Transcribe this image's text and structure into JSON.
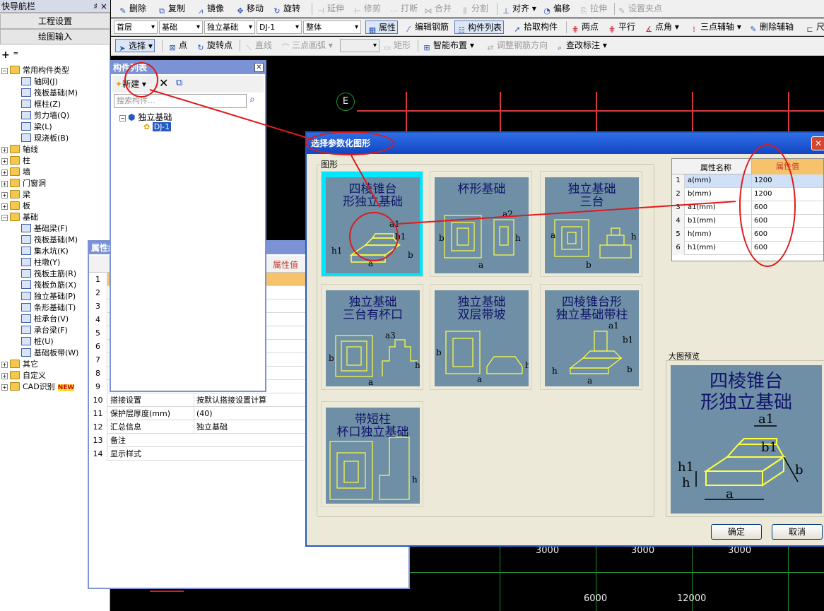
{
  "nav": {
    "title": "快导航栏",
    "pin": "♯ ×",
    "btn_settings": "工程设置",
    "btn_draw": "绘图输入",
    "tree": [
      {
        "label": "常用构件类型",
        "level": 0,
        "type": "folder",
        "exp": "−"
      },
      {
        "label": "轴网(J)",
        "level": 1,
        "type": "comp"
      },
      {
        "label": "筏板基础(M)",
        "level": 1,
        "type": "comp"
      },
      {
        "label": "框柱(Z)",
        "level": 1,
        "type": "comp"
      },
      {
        "label": "剪力墙(Q)",
        "level": 1,
        "type": "comp"
      },
      {
        "label": "梁(L)",
        "level": 1,
        "type": "comp"
      },
      {
        "label": "现浇板(B)",
        "level": 1,
        "type": "comp"
      },
      {
        "label": "轴线",
        "level": 0,
        "type": "folder",
        "exp": "+"
      },
      {
        "label": "柱",
        "level": 0,
        "type": "folder",
        "exp": "+"
      },
      {
        "label": "墙",
        "level": 0,
        "type": "folder",
        "exp": "+"
      },
      {
        "label": "门窗洞",
        "level": 0,
        "type": "folder",
        "exp": "+"
      },
      {
        "label": "梁",
        "level": 0,
        "type": "folder",
        "exp": "+"
      },
      {
        "label": "板",
        "level": 0,
        "type": "folder",
        "exp": "+"
      },
      {
        "label": "基础",
        "level": 0,
        "type": "folder",
        "exp": "−"
      },
      {
        "label": "基础梁(F)",
        "level": 1,
        "type": "comp"
      },
      {
        "label": "筏板基础(M)",
        "level": 1,
        "type": "comp"
      },
      {
        "label": "集水坑(K)",
        "level": 1,
        "type": "comp"
      },
      {
        "label": "柱墩(Y)",
        "level": 1,
        "type": "comp"
      },
      {
        "label": "筏板主筋(R)",
        "level": 1,
        "type": "comp"
      },
      {
        "label": "筏板负筋(X)",
        "level": 1,
        "type": "comp"
      },
      {
        "label": "独立基础(P)",
        "level": 1,
        "type": "comp"
      },
      {
        "label": "条形基础(T)",
        "level": 1,
        "type": "comp"
      },
      {
        "label": "桩承台(V)",
        "level": 1,
        "type": "comp"
      },
      {
        "label": "承台梁(F)",
        "level": 1,
        "type": "comp"
      },
      {
        "label": "桩(U)",
        "level": 1,
        "type": "comp"
      },
      {
        "label": "基础板带(W)",
        "level": 1,
        "type": "comp"
      },
      {
        "label": "其它",
        "level": 0,
        "type": "folder",
        "exp": "+"
      },
      {
        "label": "自定义",
        "level": 0,
        "type": "folder",
        "exp": "+"
      },
      {
        "label": "CAD识别",
        "level": 0,
        "type": "folder",
        "exp": "+",
        "badge": "NEW"
      }
    ]
  },
  "toolbar1": {
    "delete": "删除",
    "copy": "复制",
    "mirror": "镜像",
    "move": "移动",
    "rotate": "旋转",
    "extend": "延伸",
    "trim": "修剪",
    "break": "打断",
    "merge": "合并",
    "split": "分割",
    "align": "对齐",
    "offset": "偏移",
    "stretch": "拉伸",
    "set_grip": "设置夹点"
  },
  "toolbar2": {
    "floor": "首层",
    "category": "基础",
    "type": "独立基础",
    "item": "DJ-1",
    "scope": "整体",
    "props": "属性",
    "edit_rebar": "编辑钢筋",
    "comp_list": "构件列表",
    "pick": "拾取构件",
    "two_points": "两点",
    "parallel": "平行",
    "point_angle": "点角",
    "three_axis": "三点辅轴",
    "del_axis": "删除辅轴",
    "ruler": "尺"
  },
  "toolbar3": {
    "select": "选择",
    "point": "点",
    "rotate_point": "旋转点",
    "line": "直线",
    "arc": "三点画弧",
    "rect": "矩形",
    "smart": "智能布置",
    "adjust_rebar": "调整钢筋方向",
    "check_label": "查改标注"
  },
  "canvas": {
    "axis_e": "E",
    "dims_top": [
      "3000",
      "3000",
      "3000"
    ],
    "dims_bottom": [
      "6000",
      "12000"
    ]
  },
  "clist": {
    "title": "构件列表",
    "new_btn": "新建",
    "search_placeholder": "搜索构件...",
    "root": "独立基础",
    "child": "DJ-1"
  },
  "prop": {
    "title": "属性编",
    "header_val": "属性值",
    "rows": [
      {
        "n": "1",
        "k": "",
        "v": ""
      },
      {
        "n": "2",
        "k": "",
        "v": ""
      },
      {
        "n": "3",
        "k": "",
        "v": ""
      },
      {
        "n": "4",
        "k": "",
        "v": ""
      },
      {
        "n": "5",
        "k": "",
        "v": ""
      },
      {
        "n": "6",
        "k": "",
        "v": ""
      },
      {
        "n": "7",
        "k": "",
        "v": ""
      },
      {
        "n": "8",
        "k": "",
        "v": ""
      },
      {
        "n": "9",
        "k": "",
        "v": ""
      },
      {
        "n": "10",
        "k": "搭接设置",
        "v": "按默认搭接设置计算"
      },
      {
        "n": "11",
        "k": "保护层厚度(mm)",
        "v": "(40)"
      },
      {
        "n": "12",
        "k": "汇总信息",
        "v": "独立基础"
      },
      {
        "n": "13",
        "k": "备注",
        "v": ""
      },
      {
        "n": "14",
        "k": "显示样式",
        "v": ""
      }
    ]
  },
  "dialog": {
    "title": "选择参数化图形",
    "group_label": "图形",
    "preview_label": "大图预览",
    "thumbs": [
      {
        "cap": "四棱锥台\n形独立基础"
      },
      {
        "cap": "杯形基础"
      },
      {
        "cap": "独立基础\n三台"
      },
      {
        "cap": "独立基础\n三台有杯口"
      },
      {
        "cap": "独立基础\n双层带坡"
      },
      {
        "cap": "四棱锥台形\n独立基础带柱"
      },
      {
        "cap": "带短柱\n杯口独立基础"
      }
    ],
    "preview_cap": "四棱锥台\n形独立基础",
    "table_head_name": "属性名称",
    "table_head_val": "属性值",
    "params": [
      {
        "n": "1",
        "k": "a(mm)",
        "v": "1200"
      },
      {
        "n": "2",
        "k": "b(mm)",
        "v": "1200"
      },
      {
        "n": "3",
        "k": "a1(mm)",
        "v": "600"
      },
      {
        "n": "4",
        "k": "b1(mm)",
        "v": "600"
      },
      {
        "n": "5",
        "k": "h(mm)",
        "v": "600"
      },
      {
        "n": "6",
        "k": "h1(mm)",
        "v": "600"
      }
    ],
    "ok": "确定",
    "cancel": "取消"
  },
  "colors": {
    "accent": "#2458c4",
    "annotation": "#e01919",
    "thumb_bg": "#6f8fa6",
    "selected": "#00e6ff"
  }
}
